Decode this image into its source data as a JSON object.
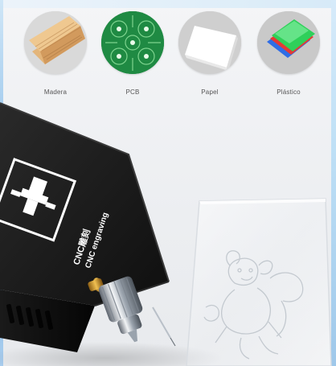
{
  "materials": [
    {
      "label": "Madera",
      "icon": "wood-icon"
    },
    {
      "label": "PCB",
      "icon": "pcb-icon"
    },
    {
      "label": "Papel",
      "icon": "paper-icon"
    },
    {
      "label": "Plástico",
      "icon": "plastic-icon"
    }
  ],
  "device": {
    "brand_line_1": "CNC雕刻",
    "brand_line_2": "CNC engraving"
  },
  "colors": {
    "device_black": "#151515",
    "accent_white": "#ffffff",
    "pcb_green": "#1f8a43",
    "plastic_green": "#2fd05a",
    "plastic_red": "#e53935",
    "plastic_blue": "#2f6de6",
    "wood": "#d2a46d"
  }
}
